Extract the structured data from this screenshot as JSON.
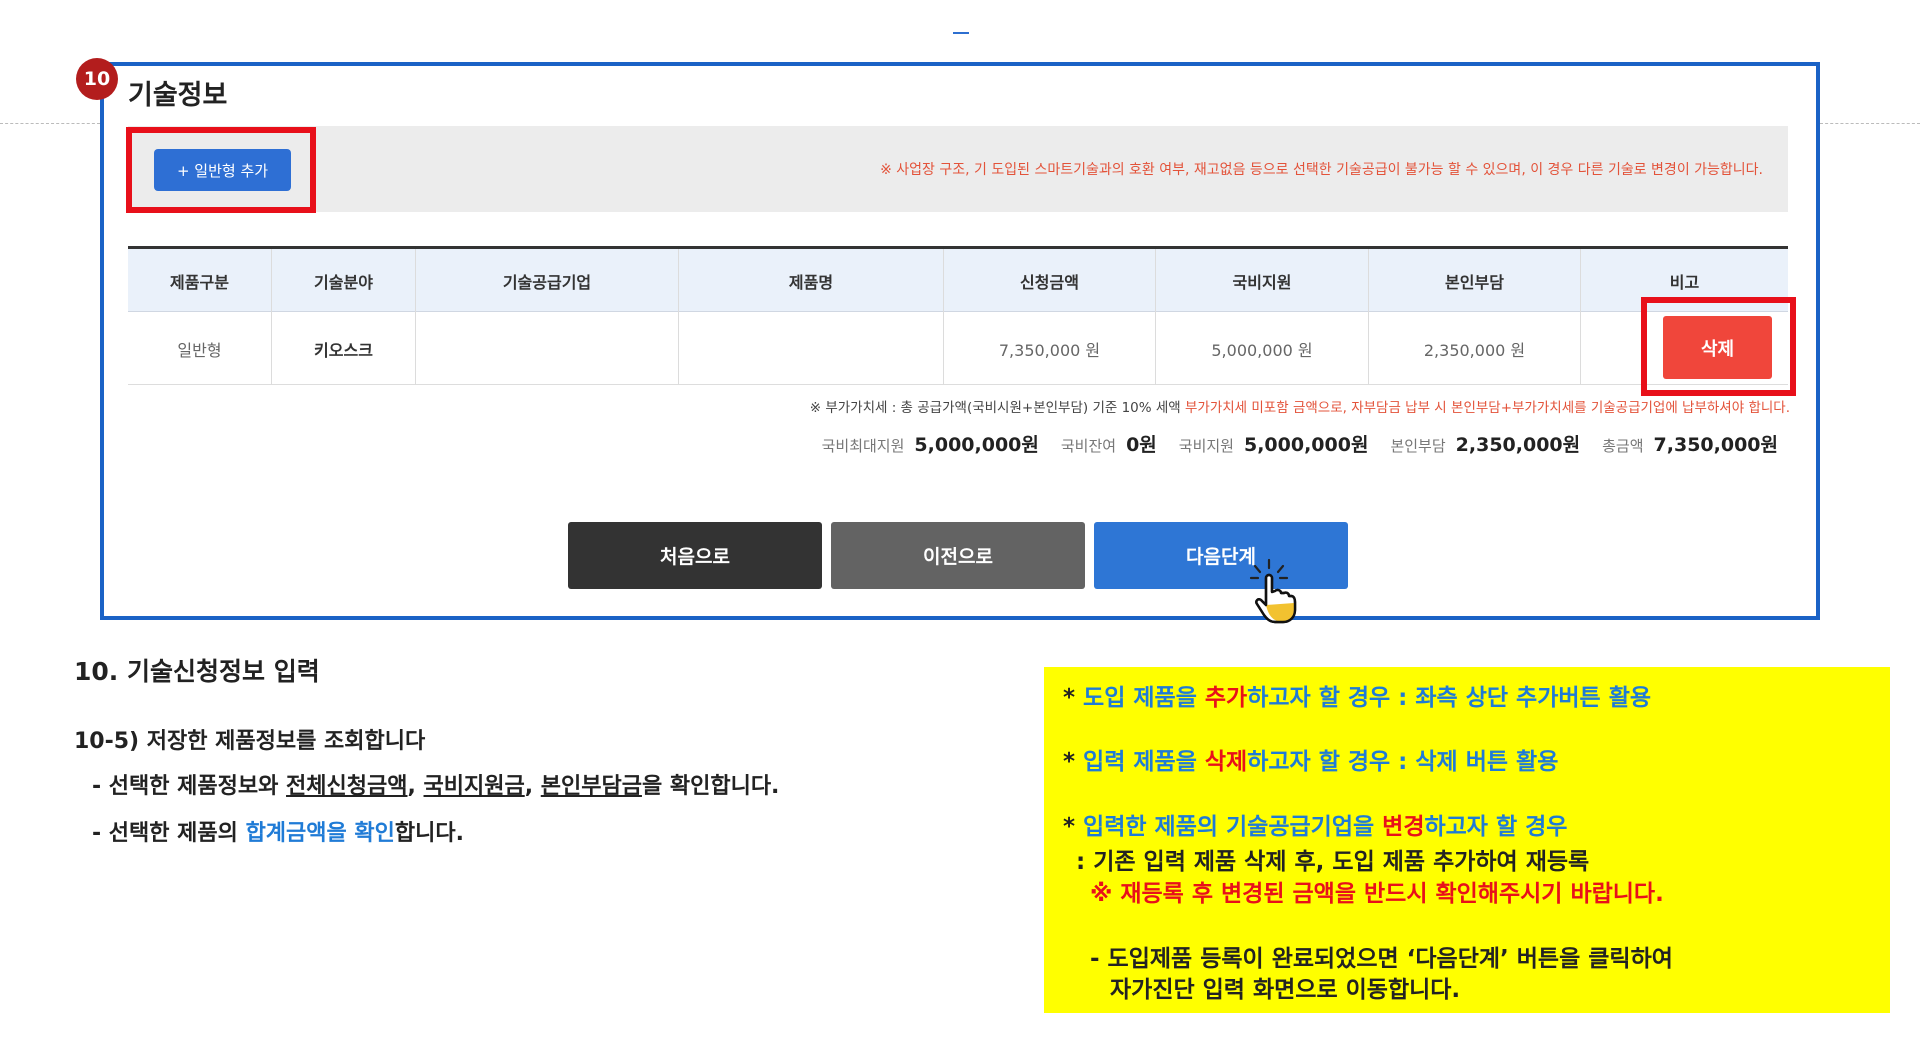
{
  "step_number": "10",
  "section_title": "기술정보",
  "add_button_label": "+ 일반형 추가",
  "top_notice": "※ 사업장 구조, 기 도입된 스마트기술과의 호환 여부, 재고없음 등으로 선택한 기술공급이 불가능 할 수 있으며, 이 경우 다른 기술로 변경이 가능합니다.",
  "table": {
    "headers": {
      "c1": "제품구분",
      "c2": "기술분야",
      "c3": "기술공급기업",
      "c4": "제품명",
      "c5": "신청금액",
      "c6": "국비지원",
      "c7": "본인부담",
      "c8": "비고"
    },
    "row": {
      "c1": "일반형",
      "c2": "키오스크",
      "c3": "",
      "c4": "",
      "c5": "7,350,000 원",
      "c6": "5,000,000 원",
      "c7": "2,350,000 원"
    },
    "delete_label": "삭제"
  },
  "vat_note": {
    "part1": "※ 부가가치세 : 총 공급가액(국비시원+본인부담) 기준 10% 세액 ",
    "part2": "부가가치세 미포함 금액으로, 자부담금 납부 시 본인부담+부가가치세를 기술공급기업에 납부하셔야 합니다."
  },
  "totals": {
    "max_label": "국비최대지원",
    "max_value": "5,000,000원",
    "remain_label": "국비잔여",
    "remain_value": "0원",
    "gov_label": "국비지원",
    "gov_value": "5,000,000원",
    "self_label": "본인부담",
    "self_value": "2,350,000원",
    "total_label": "총금액",
    "total_value": "7,350,000원"
  },
  "nav": {
    "first": "처음으로",
    "prev": "이전으로",
    "next": "다음단계"
  },
  "explanation": {
    "title": "10. 기술신청정보 입력",
    "subtitle": "10-5) 저장한 제품정보를 조회합니다",
    "line1": {
      "a": "- 선택한 제품정보와 ",
      "b": "전체신청금액",
      "c": ", ",
      "d": "국비지원금",
      "e": ", ",
      "f": "본인부담금",
      "g": "을 확인합니다."
    },
    "line2": {
      "a": "- 선택한 제품의 ",
      "b": "합계금액을 확인",
      "c": "합니다."
    }
  },
  "yellow_notes": {
    "y1": {
      "a": "* ",
      "b": "도입 제품을 ",
      "c": "추가",
      "d": "하고자 할 경우 : 좌측 상단 추가버튼 활용"
    },
    "y2": {
      "a": "* ",
      "b": "입력 제품을 ",
      "c": "삭제",
      "d": "하고자 할 경우 : 삭제 버튼 활용"
    },
    "y3": {
      "a": "* ",
      "b": "입력한 제품의 기술공급기업을 ",
      "c": "변경",
      "d": "하고자 할 경우"
    },
    "y4": ": 기존 입력 제품 삭제 후, 도입 제품 추가하여 재등록",
    "y5": "※ 재등록 후 변경된 금액을 반드시 확인해주시기 바랍니다.",
    "y6": "- 도입제품 등록이 완료되었으면 ‘다음단계’ 버튼을 클릭하여",
    "y7": {
      "a": "자가진단 입력 화면",
      "b": "으로 이동합니다."
    }
  },
  "colors": {
    "frame_blue": "#1a62c6",
    "highlight_red": "#e8101a",
    "note_blue": "#1f7bd6",
    "note_yellow": "#ffff00",
    "delete_red": "#f0463b"
  }
}
